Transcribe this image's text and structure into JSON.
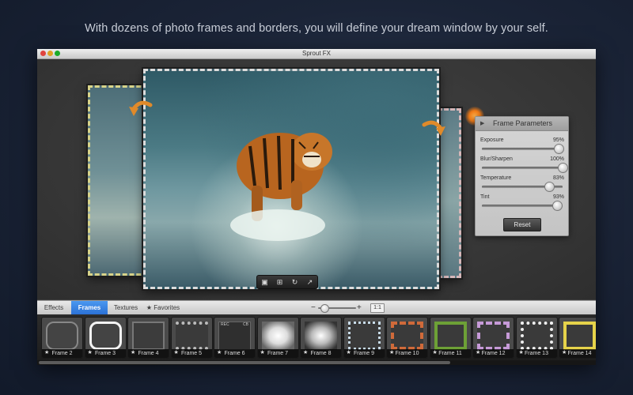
{
  "headline": "With dozens of photo frames and borders, you will define your dream window by your self.",
  "window": {
    "title": "Sprout FX"
  },
  "canvas": {
    "toolbar_icons": [
      "save-icon",
      "crop-icon",
      "rotate-icon",
      "share-icon"
    ]
  },
  "frame_parameters": {
    "title": "Frame Parameters",
    "params": [
      {
        "label": "Exposure",
        "value": "95%",
        "level": 0.95
      },
      {
        "label": "Blur/Sharpen",
        "value": "100%",
        "level": 1.0
      },
      {
        "label": "Temperature",
        "value": "83%",
        "level": 0.83
      },
      {
        "label": "Tint",
        "value": "93%",
        "level": 0.93
      }
    ],
    "reset_label": "Reset"
  },
  "tabs": [
    {
      "label": "Effects",
      "active": false
    },
    {
      "label": "Frames",
      "active": true
    },
    {
      "label": "Textures",
      "active": false
    },
    {
      "label": "★ Favorites",
      "active": false
    }
  ],
  "zoom": {
    "minus": "−",
    "plus": "+",
    "one_to_one": "1:1",
    "level": 0.1
  },
  "filmstrip": [
    {
      "label": "Frame 2",
      "style": "rounded"
    },
    {
      "label": "Frame 3",
      "style": "rounded-white"
    },
    {
      "label": "Frame 4",
      "style": "plain"
    },
    {
      "label": "Frame 5",
      "style": "film"
    },
    {
      "label": "Frame 6",
      "style": "rec"
    },
    {
      "label": "Frame 7",
      "style": "brush"
    },
    {
      "label": "Frame 8",
      "style": "grunge"
    },
    {
      "label": "Frame 9",
      "style": "lace"
    },
    {
      "label": "Frame 10",
      "style": "zigzag"
    },
    {
      "label": "Frame 11",
      "style": "green"
    },
    {
      "label": "Frame 12",
      "style": "check"
    },
    {
      "label": "Frame 13",
      "style": "swirl"
    },
    {
      "label": "Frame 14",
      "style": "yellow"
    }
  ],
  "rec_text": "REC",
  "cb_text": "CB"
}
